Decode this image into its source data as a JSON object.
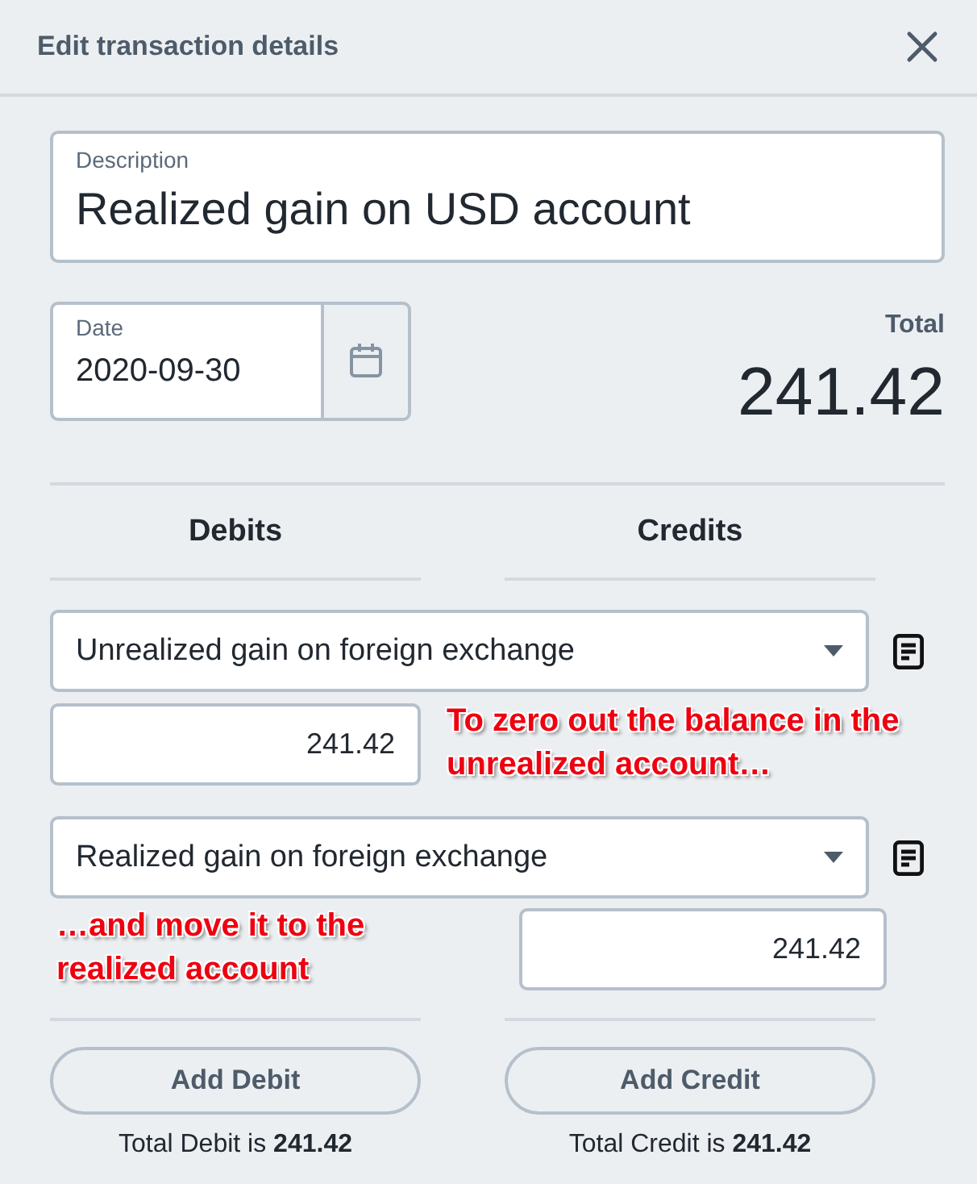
{
  "dialog": {
    "title": "Edit transaction details"
  },
  "description": {
    "label": "Description",
    "value": "Realized gain on USD account"
  },
  "date": {
    "label": "Date",
    "value": "2020-09-30"
  },
  "total": {
    "label": "Total",
    "value": "241.42"
  },
  "columns": [
    {
      "heading": "Debits"
    },
    {
      "heading": "Credits"
    }
  ],
  "entries": [
    {
      "kind": "debit",
      "account": "Unrealized gain on foreign exchange",
      "amount": "241.42",
      "annotation": "To zero out the balance in the unrealized account…"
    },
    {
      "kind": "credit",
      "account": "Realized gain on foreign exchange",
      "amount": "241.42",
      "annotation": "…and move it to the realized account"
    }
  ],
  "buttons": [
    "Add Debit",
    "Add Credit"
  ],
  "totals": [
    "Total Debit is **241.42**",
    "Total Credit is **241.42**"
  ]
}
